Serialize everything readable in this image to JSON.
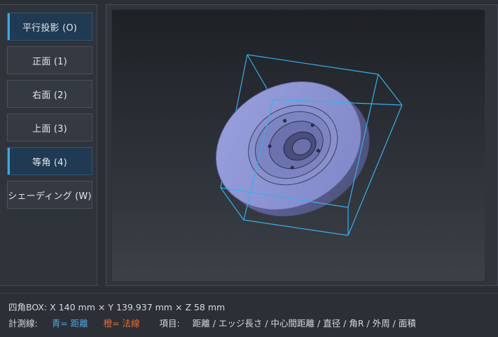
{
  "sidebar": {
    "buttons": [
      {
        "label": "平行投影 (O)",
        "active": true
      },
      {
        "label": "正面 (1)",
        "active": false
      },
      {
        "label": "右面 (2)",
        "active": false
      },
      {
        "label": "上面 (3)",
        "active": false
      },
      {
        "label": "等角 (4)",
        "active": true
      },
      {
        "label": "シェーディング (W)",
        "active": false
      }
    ]
  },
  "status": {
    "box_label": "四角BOX:",
    "box_x": "X 140 mm",
    "box_y": "Y 139.937 mm",
    "box_z": "Z 58 mm",
    "times": "×",
    "measure_label": "計測線:",
    "blue_text": "青= 距離",
    "orange_text": "橙= 法線",
    "items_label": "項目:",
    "items": "距離 / エッジ長さ / 中心間距離 / 直径 / 角R / 外周 / 面積"
  },
  "colors": {
    "accent_blue": "#48a9e8",
    "accent_orange": "#f06a2a",
    "bbox_line": "#2fb2f0",
    "part_face": "#8e95d4",
    "part_side": "#5d6293"
  }
}
